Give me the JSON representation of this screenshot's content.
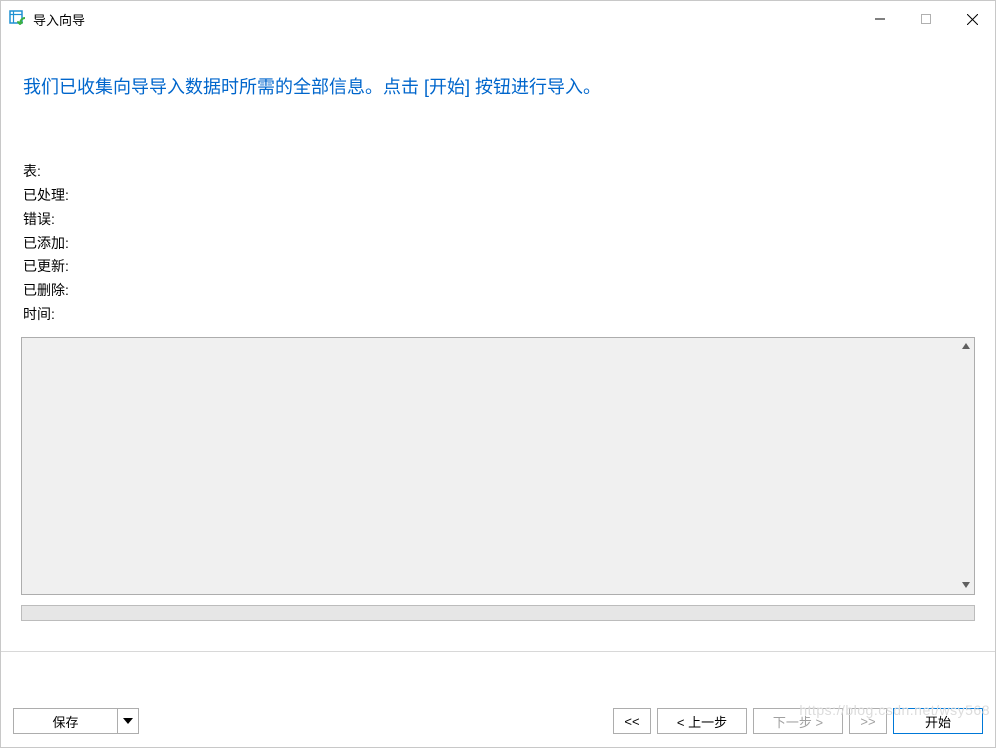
{
  "window": {
    "title": "导入向导"
  },
  "instruction": "我们已收集向导导入数据时所需的全部信息。点击 [开始] 按钮进行导入。",
  "status": {
    "table_label": "表:",
    "processed_label": "已处理:",
    "error_label": "错误:",
    "added_label": "已添加:",
    "updated_label": "已更新:",
    "deleted_label": "已删除:",
    "time_label": "时间:"
  },
  "footer": {
    "save": "保存",
    "first": "<<",
    "prev": "< 上一步",
    "next": "下一步 >",
    "last": ">>",
    "start": "开始"
  },
  "watermark": "https://blog.csdn.net/wsy568"
}
